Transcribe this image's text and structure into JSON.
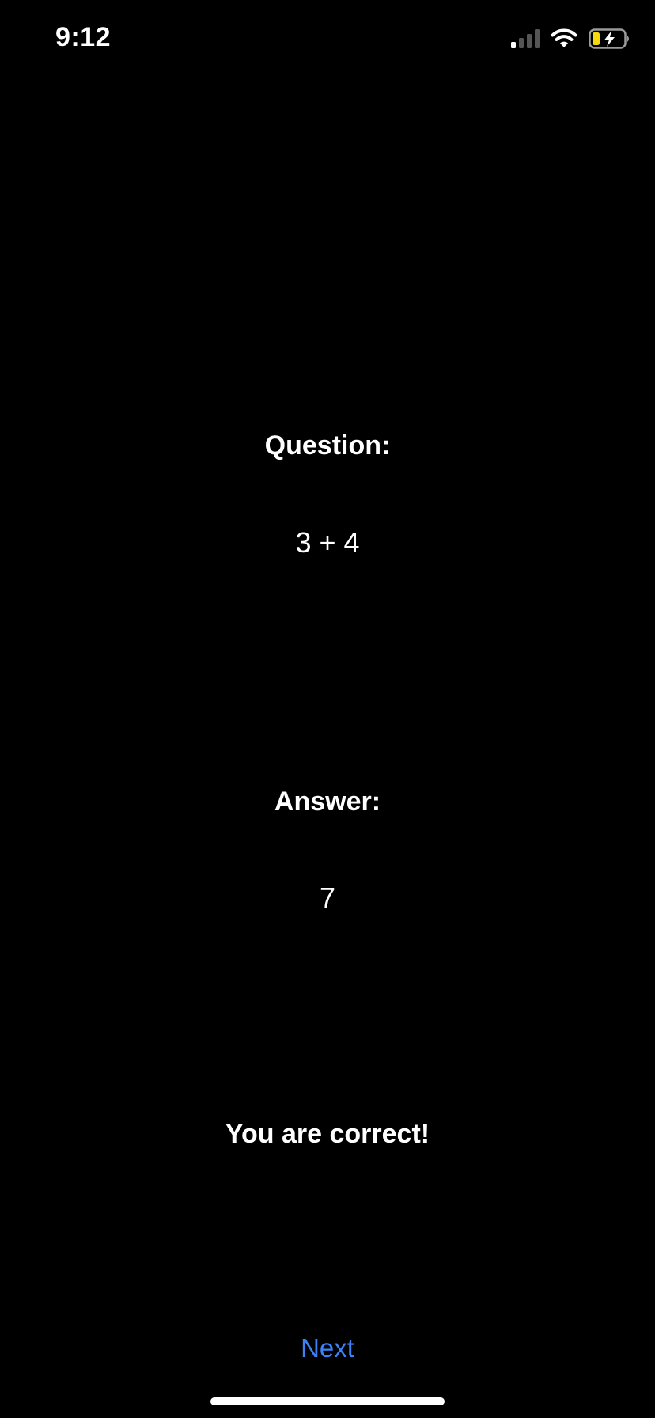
{
  "status_bar": {
    "time": "9:12",
    "icons": [
      "cellular-signal-icon",
      "wifi-icon",
      "battery-charging-icon"
    ],
    "battery_color": "#f5d90a"
  },
  "question": {
    "label": "Question:",
    "value": "3 + 4"
  },
  "answer": {
    "label": "Answer:",
    "value": "7"
  },
  "result": {
    "text": "You are correct!"
  },
  "actions": {
    "next_label": "Next",
    "accent_color": "#3b82f6"
  }
}
